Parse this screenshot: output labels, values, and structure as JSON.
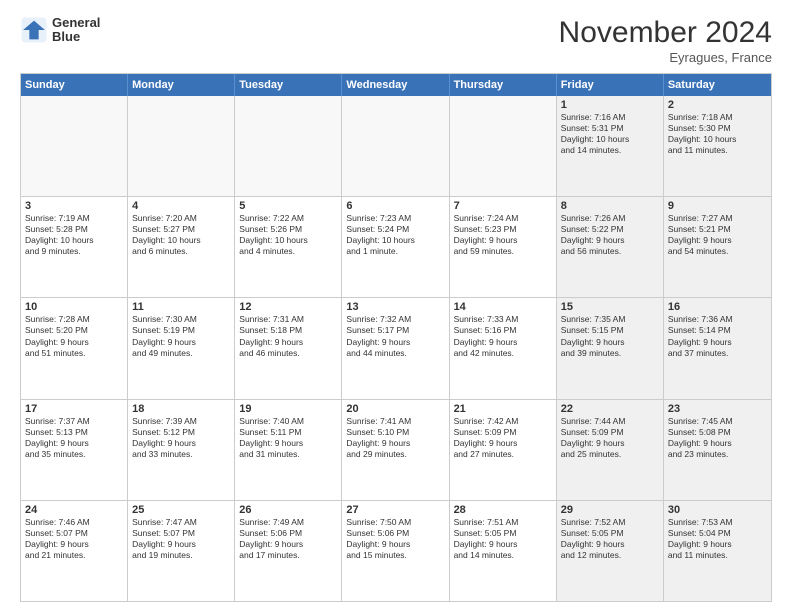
{
  "header": {
    "logo_line1": "General",
    "logo_line2": "Blue",
    "month": "November 2024",
    "location": "Eyragues, France"
  },
  "weekdays": [
    "Sunday",
    "Monday",
    "Tuesday",
    "Wednesday",
    "Thursday",
    "Friday",
    "Saturday"
  ],
  "rows": [
    [
      {
        "day": "",
        "info": "",
        "empty": true
      },
      {
        "day": "",
        "info": "",
        "empty": true
      },
      {
        "day": "",
        "info": "",
        "empty": true
      },
      {
        "day": "",
        "info": "",
        "empty": true
      },
      {
        "day": "",
        "info": "",
        "empty": true
      },
      {
        "day": "1",
        "info": "Sunrise: 7:16 AM\nSunset: 5:31 PM\nDaylight: 10 hours\nand 14 minutes.",
        "empty": false
      },
      {
        "day": "2",
        "info": "Sunrise: 7:18 AM\nSunset: 5:30 PM\nDaylight: 10 hours\nand 11 minutes.",
        "empty": false
      }
    ],
    [
      {
        "day": "3",
        "info": "Sunrise: 7:19 AM\nSunset: 5:28 PM\nDaylight: 10 hours\nand 9 minutes.",
        "empty": false
      },
      {
        "day": "4",
        "info": "Sunrise: 7:20 AM\nSunset: 5:27 PM\nDaylight: 10 hours\nand 6 minutes.",
        "empty": false
      },
      {
        "day": "5",
        "info": "Sunrise: 7:22 AM\nSunset: 5:26 PM\nDaylight: 10 hours\nand 4 minutes.",
        "empty": false
      },
      {
        "day": "6",
        "info": "Sunrise: 7:23 AM\nSunset: 5:24 PM\nDaylight: 10 hours\nand 1 minute.",
        "empty": false
      },
      {
        "day": "7",
        "info": "Sunrise: 7:24 AM\nSunset: 5:23 PM\nDaylight: 9 hours\nand 59 minutes.",
        "empty": false
      },
      {
        "day": "8",
        "info": "Sunrise: 7:26 AM\nSunset: 5:22 PM\nDaylight: 9 hours\nand 56 minutes.",
        "empty": false
      },
      {
        "day": "9",
        "info": "Sunrise: 7:27 AM\nSunset: 5:21 PM\nDaylight: 9 hours\nand 54 minutes.",
        "empty": false
      }
    ],
    [
      {
        "day": "10",
        "info": "Sunrise: 7:28 AM\nSunset: 5:20 PM\nDaylight: 9 hours\nand 51 minutes.",
        "empty": false
      },
      {
        "day": "11",
        "info": "Sunrise: 7:30 AM\nSunset: 5:19 PM\nDaylight: 9 hours\nand 49 minutes.",
        "empty": false
      },
      {
        "day": "12",
        "info": "Sunrise: 7:31 AM\nSunset: 5:18 PM\nDaylight: 9 hours\nand 46 minutes.",
        "empty": false
      },
      {
        "day": "13",
        "info": "Sunrise: 7:32 AM\nSunset: 5:17 PM\nDaylight: 9 hours\nand 44 minutes.",
        "empty": false
      },
      {
        "day": "14",
        "info": "Sunrise: 7:33 AM\nSunset: 5:16 PM\nDaylight: 9 hours\nand 42 minutes.",
        "empty": false
      },
      {
        "day": "15",
        "info": "Sunrise: 7:35 AM\nSunset: 5:15 PM\nDaylight: 9 hours\nand 39 minutes.",
        "empty": false
      },
      {
        "day": "16",
        "info": "Sunrise: 7:36 AM\nSunset: 5:14 PM\nDaylight: 9 hours\nand 37 minutes.",
        "empty": false
      }
    ],
    [
      {
        "day": "17",
        "info": "Sunrise: 7:37 AM\nSunset: 5:13 PM\nDaylight: 9 hours\nand 35 minutes.",
        "empty": false
      },
      {
        "day": "18",
        "info": "Sunrise: 7:39 AM\nSunset: 5:12 PM\nDaylight: 9 hours\nand 33 minutes.",
        "empty": false
      },
      {
        "day": "19",
        "info": "Sunrise: 7:40 AM\nSunset: 5:11 PM\nDaylight: 9 hours\nand 31 minutes.",
        "empty": false
      },
      {
        "day": "20",
        "info": "Sunrise: 7:41 AM\nSunset: 5:10 PM\nDaylight: 9 hours\nand 29 minutes.",
        "empty": false
      },
      {
        "day": "21",
        "info": "Sunrise: 7:42 AM\nSunset: 5:09 PM\nDaylight: 9 hours\nand 27 minutes.",
        "empty": false
      },
      {
        "day": "22",
        "info": "Sunrise: 7:44 AM\nSunset: 5:09 PM\nDaylight: 9 hours\nand 25 minutes.",
        "empty": false
      },
      {
        "day": "23",
        "info": "Sunrise: 7:45 AM\nSunset: 5:08 PM\nDaylight: 9 hours\nand 23 minutes.",
        "empty": false
      }
    ],
    [
      {
        "day": "24",
        "info": "Sunrise: 7:46 AM\nSunset: 5:07 PM\nDaylight: 9 hours\nand 21 minutes.",
        "empty": false
      },
      {
        "day": "25",
        "info": "Sunrise: 7:47 AM\nSunset: 5:07 PM\nDaylight: 9 hours\nand 19 minutes.",
        "empty": false
      },
      {
        "day": "26",
        "info": "Sunrise: 7:49 AM\nSunset: 5:06 PM\nDaylight: 9 hours\nand 17 minutes.",
        "empty": false
      },
      {
        "day": "27",
        "info": "Sunrise: 7:50 AM\nSunset: 5:06 PM\nDaylight: 9 hours\nand 15 minutes.",
        "empty": false
      },
      {
        "day": "28",
        "info": "Sunrise: 7:51 AM\nSunset: 5:05 PM\nDaylight: 9 hours\nand 14 minutes.",
        "empty": false
      },
      {
        "day": "29",
        "info": "Sunrise: 7:52 AM\nSunset: 5:05 PM\nDaylight: 9 hours\nand 12 minutes.",
        "empty": false
      },
      {
        "day": "30",
        "info": "Sunrise: 7:53 AM\nSunset: 5:04 PM\nDaylight: 9 hours\nand 11 minutes.",
        "empty": false
      }
    ]
  ]
}
